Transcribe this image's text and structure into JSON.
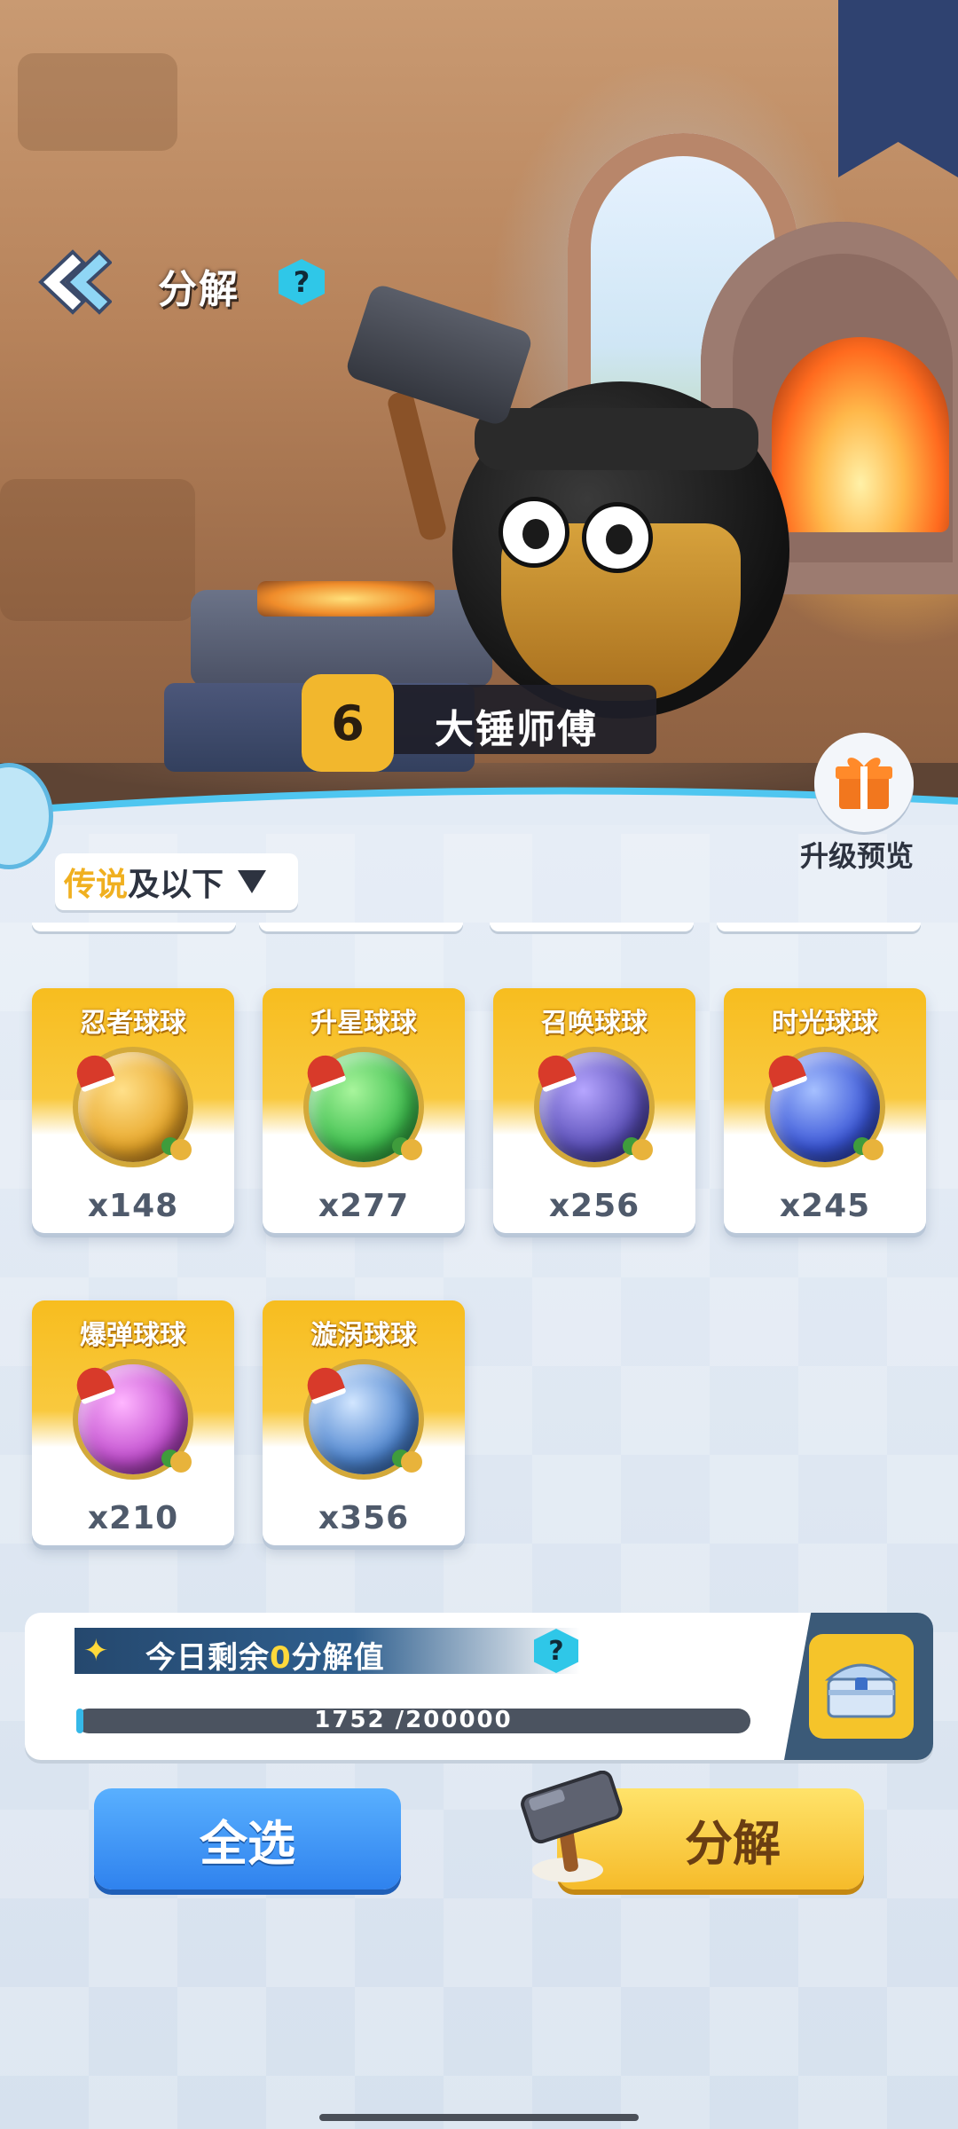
{
  "header": {
    "title": "分解",
    "help_label": "?"
  },
  "master": {
    "level": "6",
    "name": "大锤师傅"
  },
  "upgrade_preview": {
    "label": "升级预览"
  },
  "filter": {
    "highlight": "传说",
    "rest": "及以下"
  },
  "items": [
    {
      "name": "忍者球球",
      "count": "x148",
      "color": "#e8a72a"
    },
    {
      "name": "升星球球",
      "count": "x277",
      "color": "#3fbf4f"
    },
    {
      "name": "召唤球球",
      "count": "x256",
      "color": "#5a4fb8"
    },
    {
      "name": "时光球球",
      "count": "x245",
      "color": "#3b57d8"
    },
    {
      "name": "爆弹球球",
      "count": "x210",
      "color": "#c24fcf"
    },
    {
      "name": "漩涡球球",
      "count": "x356",
      "color": "#4f86d0"
    }
  ],
  "daily": {
    "prefix": "今日剩余",
    "value": "0",
    "suffix": "分解值",
    "help_label": "?",
    "progress_text": "1752 /200000",
    "progress_fraction": 0.00876
  },
  "buttons": {
    "select_all": "全选",
    "decompose": "分解"
  }
}
